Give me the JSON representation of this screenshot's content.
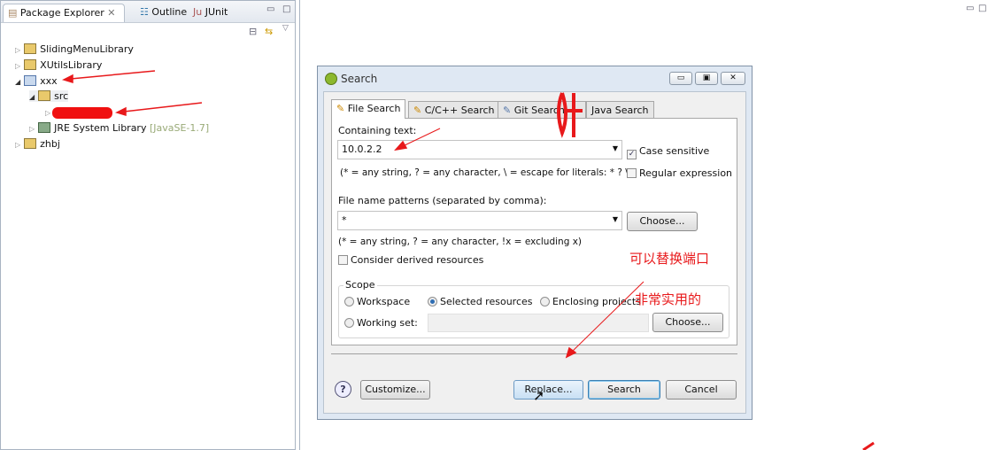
{
  "left_panel": {
    "tabs": [
      "Package Explorer",
      "Outline",
      "JUnit"
    ],
    "tree": [
      {
        "label": "SlidingMenuLibrary",
        "expanded": false
      },
      {
        "label": "XUtilsLibrary",
        "expanded": false
      },
      {
        "label": "xxx",
        "expanded": true
      },
      {
        "label": "src",
        "expanded": true
      },
      {
        "label": "JRE System Library",
        "suffix": "[JavaSE-1.7]",
        "expanded": false
      },
      {
        "label": "zhbj",
        "expanded": false
      }
    ]
  },
  "dialog": {
    "title": "Search",
    "tabs": [
      "File Search",
      "C/C++ Search",
      "Git Search",
      "Java Search"
    ],
    "containing_label": "Containing text:",
    "containing_value": "10.0.2.2",
    "case_sensitive": "Case sensitive",
    "case_checked": true,
    "hint1": "(* = any string, ? = any character, \\ = escape for literals: * ? \\)",
    "regex": "Regular expression",
    "regex_checked": false,
    "patterns_label": "File name patterns (separated by comma):",
    "patterns_value": "*",
    "choose": "Choose...",
    "hint2": "(* = any string, ? = any character, !x = excluding x)",
    "derived": "Consider derived resources",
    "scope": {
      "title": "Scope",
      "workspace": "Workspace",
      "selected": "Selected resources",
      "enclosing": "Enclosing projects",
      "working_set": "Working set:",
      "choose": "Choose...",
      "selected_option": "Selected resources"
    },
    "buttons": {
      "help": "?",
      "customize": "Customize...",
      "replace": "Replace...",
      "search": "Search",
      "cancel": "Cancel"
    }
  },
  "annotations": {
    "note1": "可以替换端口",
    "note2": "非常实用的",
    "scribble": "0+"
  },
  "colors": {
    "annotation": "#e8191b",
    "accent": "#2e6db3"
  }
}
